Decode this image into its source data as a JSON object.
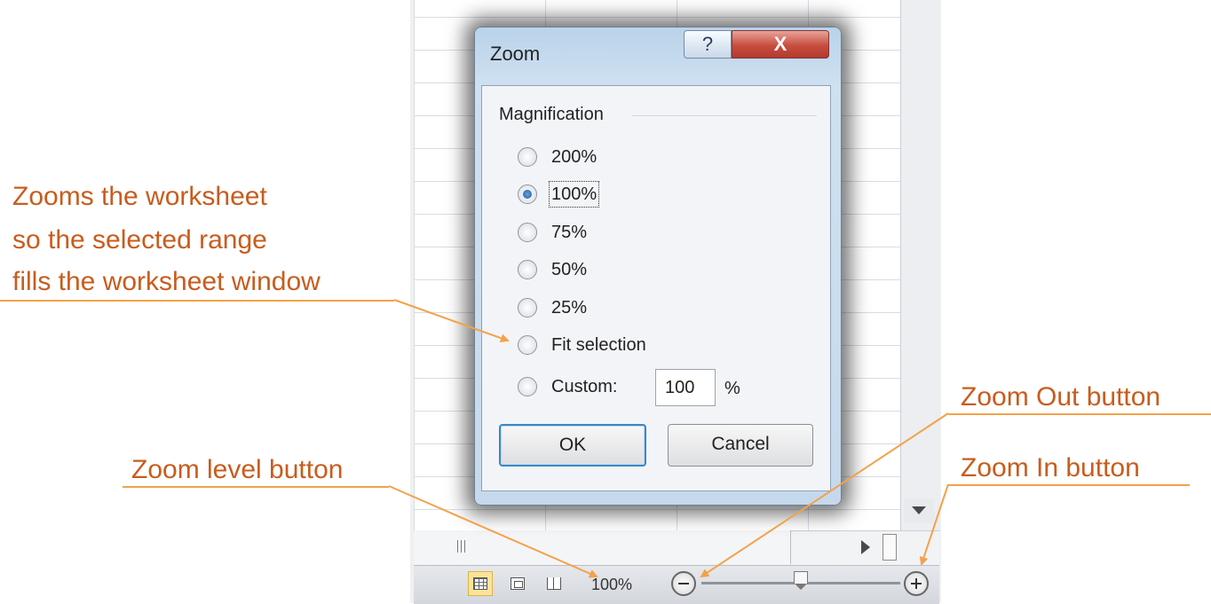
{
  "dialog": {
    "title": "Zoom",
    "help_glyph": "?",
    "close_glyph": "X",
    "group_label": "Magnification",
    "options": [
      {
        "label": "200%",
        "checked": false
      },
      {
        "label": "100%",
        "checked": true
      },
      {
        "label": "75%",
        "checked": false
      },
      {
        "label": "50%",
        "checked": false
      },
      {
        "label": "25%",
        "checked": false
      },
      {
        "label": "Fit selection",
        "checked": false
      },
      {
        "label": "Custom:",
        "checked": false
      }
    ],
    "custom_value": "100",
    "percent_sign": "%",
    "ok_label": "OK",
    "cancel_label": "Cancel"
  },
  "status_bar": {
    "zoom_level": "100%",
    "view_buttons": [
      "normal-view-icon",
      "page-layout-icon",
      "page-break-preview-icon"
    ],
    "zoom_slider_percent": 100
  },
  "annotations": {
    "fit_selection": [
      "Zooms the worksheet",
      "so the selected range",
      "fills the worksheet window"
    ],
    "zoom_level_button": "Zoom level button",
    "zoom_out_button": "Zoom Out button",
    "zoom_in_button": "Zoom In button"
  },
  "colors": {
    "annotation_text": "#c85c1d",
    "annotation_line": "#f3a24a",
    "close_button": "#c74d3f",
    "active_view": "#fbe49a"
  }
}
